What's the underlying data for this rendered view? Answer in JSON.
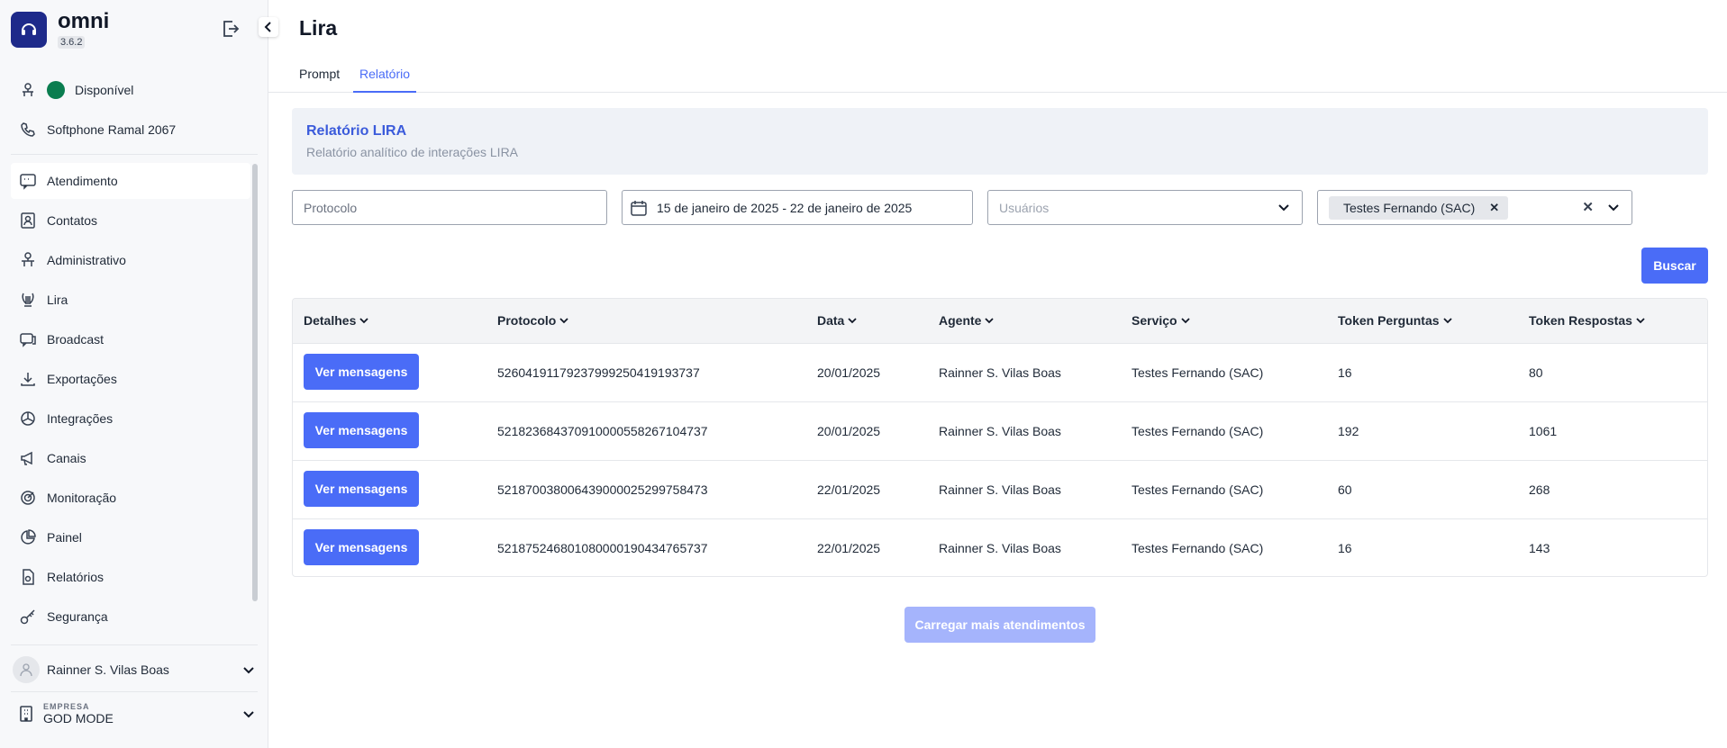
{
  "app": {
    "name": "omni",
    "version": "3.6.2"
  },
  "sidebar": {
    "status_label": "Disponível",
    "status_color": "#0a7d4f",
    "softphone_label": "Softphone Ramal 2067",
    "items": [
      {
        "label": "Atendimento",
        "icon": "chat-icon"
      },
      {
        "label": "Contatos",
        "icon": "contact-card-icon"
      },
      {
        "label": "Administrativo",
        "icon": "admin-icon"
      },
      {
        "label": "Lira",
        "icon": "lyre-icon"
      },
      {
        "label": "Broadcast",
        "icon": "broadcast-icon"
      },
      {
        "label": "Exportações",
        "icon": "download-icon"
      },
      {
        "label": "Integrações",
        "icon": "integration-icon"
      },
      {
        "label": "Canais",
        "icon": "megaphone-icon"
      },
      {
        "label": "Monitoração",
        "icon": "monitor-icon"
      },
      {
        "label": "Painel",
        "icon": "pie-chart-icon"
      },
      {
        "label": "Relatórios",
        "icon": "report-icon"
      },
      {
        "label": "Segurança",
        "icon": "key-icon"
      }
    ],
    "user_name": "Rainner S. Vilas Boas",
    "company_label": "EMPRESA",
    "company_name": "GOD MODE"
  },
  "page": {
    "title": "Lira",
    "tabs": [
      {
        "label": "Prompt"
      },
      {
        "label": "Relatório"
      }
    ],
    "active_tab": "Relatório"
  },
  "banner": {
    "title": "Relatório LIRA",
    "subtitle": "Relatório analítico de interações LIRA"
  },
  "filters": {
    "protocol_placeholder": "Protocolo",
    "date_range": "15 de janeiro de 2025 - 22 de janeiro de 2025",
    "users_placeholder": "Usuários",
    "service_chip": "Testes Fernando (SAC)",
    "search_label": "Buscar"
  },
  "table": {
    "columns": [
      "Detalhes",
      "Protocolo",
      "Data",
      "Agente",
      "Serviço",
      "Token Perguntas",
      "Token Respostas"
    ],
    "view_label": "Ver mensagens",
    "rows": [
      {
        "protocolo": "526041911792379992504191937​37",
        "data": "20/01/2025",
        "agente": "Rainner S. Vilas Boas",
        "servico": "Testes Fernando (SAC)",
        "perguntas": "16",
        "respostas": "80"
      },
      {
        "protocolo": "52182368437091000055826710473​7",
        "data": "20/01/2025",
        "agente": "Rainner S. Vilas Boas",
        "servico": "Testes Fernando (SAC)",
        "perguntas": "192",
        "respostas": "1061"
      },
      {
        "protocolo": "521870038006439000025299758473",
        "data": "22/01/2025",
        "agente": "Rainner S. Vilas Boas",
        "servico": "Testes Fernando (SAC)",
        "perguntas": "60",
        "respostas": "268"
      },
      {
        "protocolo": "521875246801080000190434765737",
        "data": "22/01/2025",
        "agente": "Rainner S. Vilas Boas",
        "servico": "Testes Fernando (SAC)",
        "perguntas": "16",
        "respostas": "143"
      }
    ]
  },
  "load_more_label": "Carregar mais atendimentos",
  "colors": {
    "primary": "#4a6cf7",
    "primary_disabled": "#a5b4fc",
    "brand_dark": "#1e2a8a"
  }
}
